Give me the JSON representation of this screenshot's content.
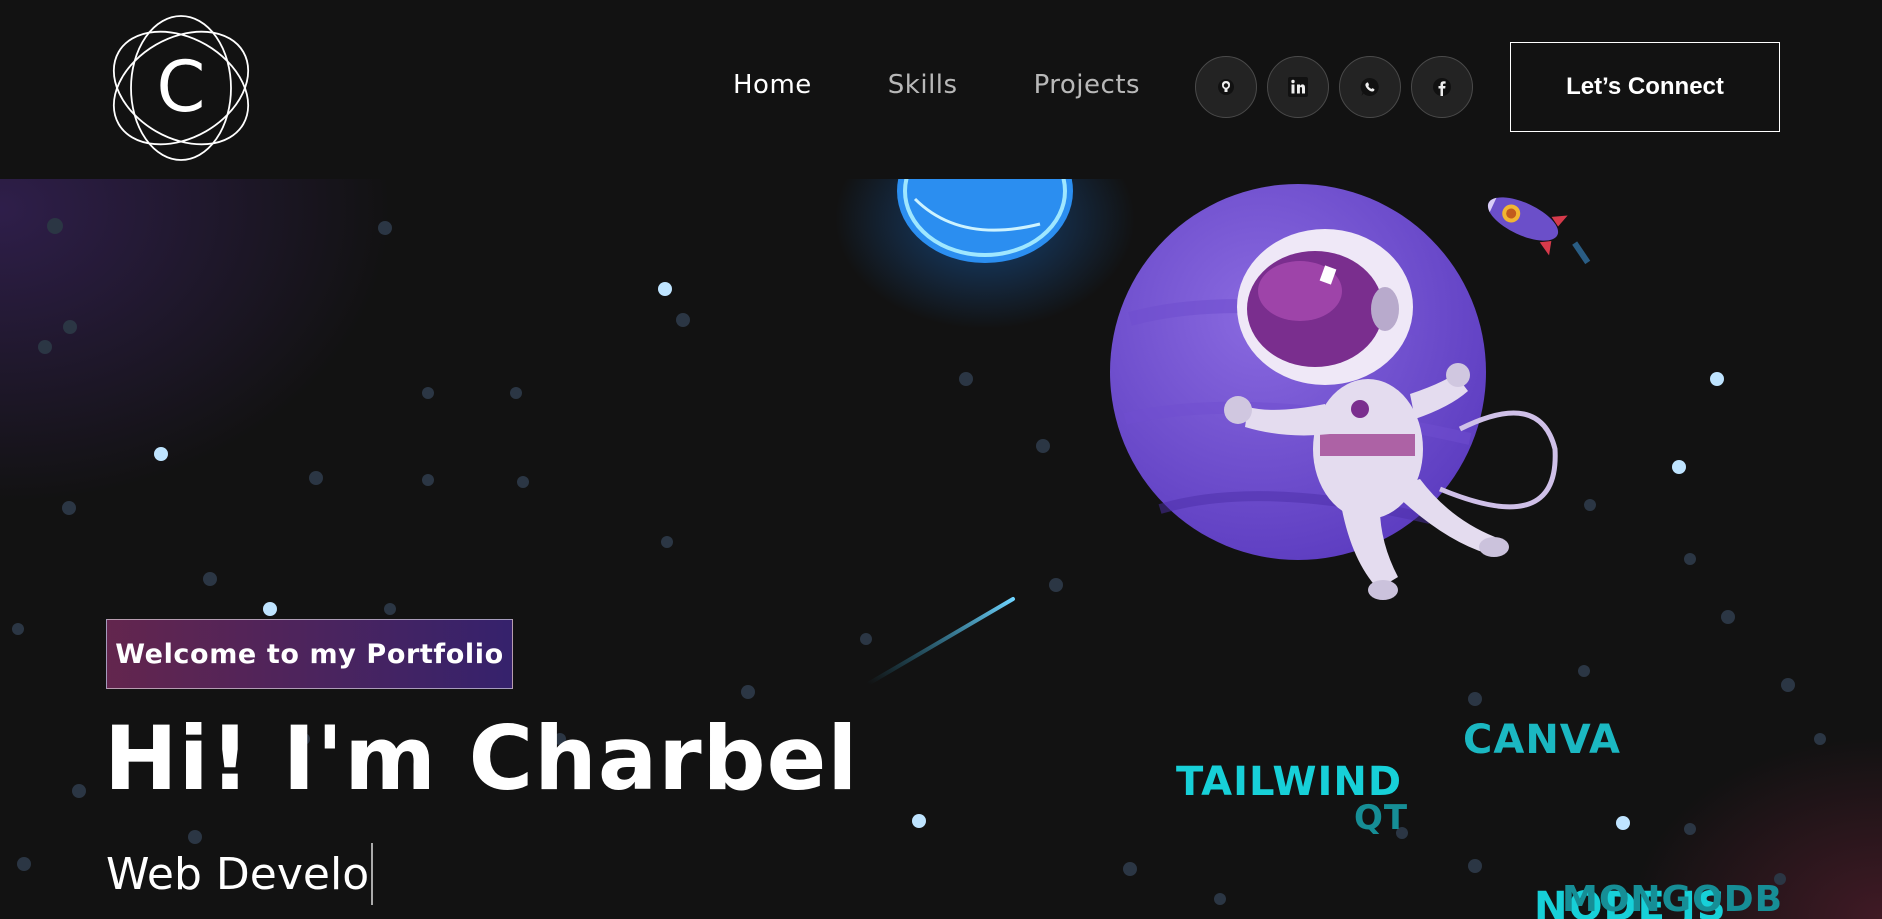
{
  "logo": {
    "letter": "C"
  },
  "nav": {
    "links": [
      {
        "label": "Home"
      },
      {
        "label": "Skills"
      },
      {
        "label": "Projects"
      }
    ],
    "socials": [
      {
        "icon": "github-icon"
      },
      {
        "icon": "linkedin-icon"
      },
      {
        "icon": "whatsapp-icon"
      },
      {
        "icon": "facebook-icon"
      }
    ],
    "cta_label": "Let’s Connect"
  },
  "hero": {
    "badge": "Welcome to my Portfolio",
    "title": "Hi! I'm Charbel",
    "subtitle": "Web Develo"
  },
  "skills_cloud": [
    {
      "label": "CANVA"
    },
    {
      "label": "TAILWIND"
    },
    {
      "label": "QT"
    },
    {
      "label": "NODE JS"
    },
    {
      "label": "MONGODB"
    }
  ],
  "colors": {
    "background": "#121212",
    "badge_start": "#aa367c",
    "badge_end": "#4a2fbd",
    "skill_text": "#17b8bf",
    "planet": "#7b58d6"
  }
}
